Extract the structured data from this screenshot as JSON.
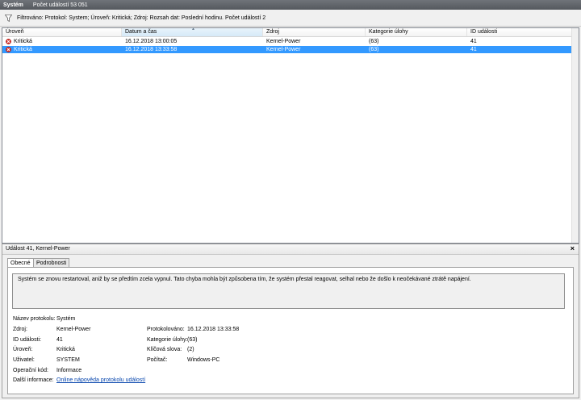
{
  "titlebar": {
    "title": "Systém",
    "count": "Počet událostí 53 051"
  },
  "filter": {
    "text": "Filtrováno: Protokol: System; Úroveň: Kritická; Zdroj: Rozsah dat: Poslední hodinu. Počet událostí 2"
  },
  "columns": [
    "Úroveň",
    "Datum a čas",
    "Zdroj",
    "Kategorie úlohy",
    "ID události"
  ],
  "rows": [
    {
      "level": "Kritická",
      "datetime": "16.12.2018 13:00:05",
      "source": "Kernel-Power",
      "category": "(63)",
      "id": "41"
    },
    {
      "level": "Kritická",
      "datetime": "16.12.2018 13:33:58",
      "source": "Kernel-Power",
      "category": "(63)",
      "id": "41"
    }
  ],
  "detail": {
    "title": "Událost 41, Kernel-Power",
    "close": "×",
    "tabs": [
      "Obecné",
      "Podrobnosti"
    ],
    "message": "Systém se znovu restartoval, aniž by se předtím zcela vypnul. Tato chyba mohla být způsobena tím, že systém přestal reagovat, selhal nebo že došlo k neočekávané ztrátě napájení.",
    "fields": {
      "protocol_name_label": "Název protokolu:",
      "protocol_name": "Systém",
      "source_label": "Zdroj:",
      "source": "Kernel-Power",
      "logged_label": "Protokolováno:",
      "logged": "16.12.2018 13:33:58",
      "event_id_label": "ID události:",
      "event_id": "41",
      "task_category_label": "Kategorie úlohy:",
      "task_category": "(63)",
      "level_label": "Úroveň:",
      "level": "Kritická",
      "keywords_label": "Klíčová slova:",
      "keywords": "(2)",
      "user_label": "Uživatel:",
      "user": "SYSTEM",
      "computer_label": "Počítač:",
      "computer": "Windows-PC",
      "opcode_label": "Operační kód:",
      "opcode": "Informace",
      "more_info_label": "Další informace:",
      "more_info_link": "Online nápověda protokolu událostí"
    }
  },
  "colors": {
    "selection": "#3399ff",
    "link": "#0645ad",
    "titlebar": "#5f6368"
  }
}
